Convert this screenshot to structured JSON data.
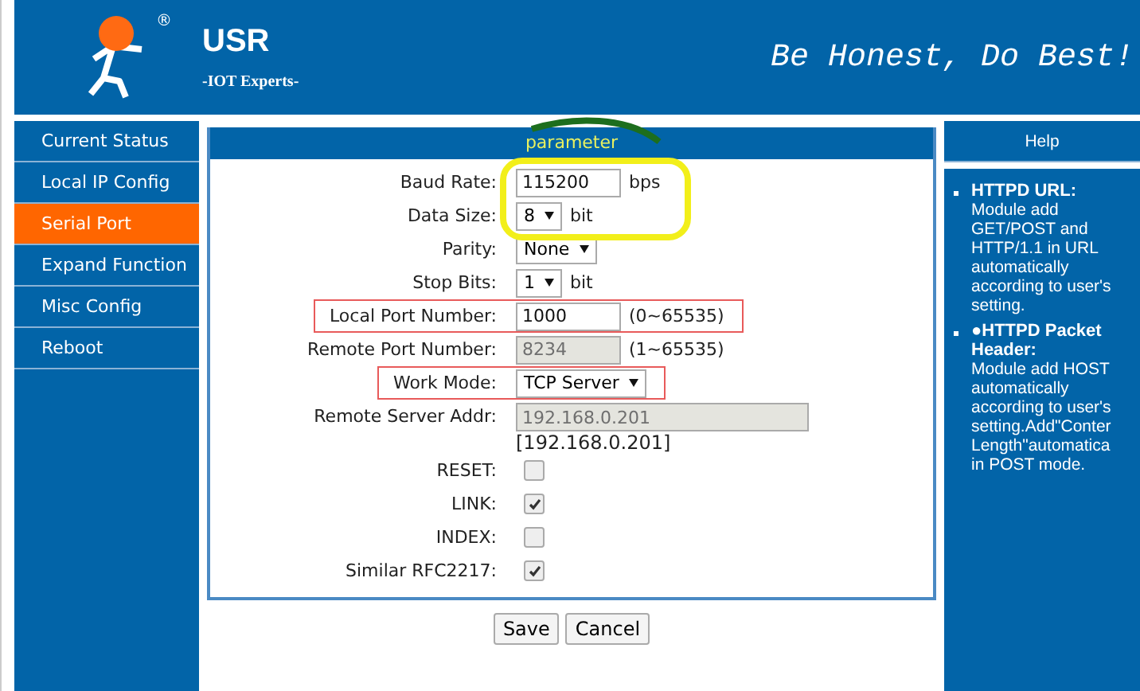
{
  "header": {
    "brand": "USR",
    "tagline": "-IOT Experts-",
    "slogan": "Be Honest, Do Best!",
    "registered": "®"
  },
  "sidebar": {
    "items": [
      {
        "label": "Current Status",
        "selected": false
      },
      {
        "label": "Local IP Config",
        "selected": false
      },
      {
        "label": "Serial Port",
        "selected": true
      },
      {
        "label": "Expand Function",
        "selected": false
      },
      {
        "label": "Misc Config",
        "selected": false
      },
      {
        "label": "Reboot",
        "selected": false
      }
    ]
  },
  "form": {
    "title": "parameter",
    "rows": [
      {
        "kind": "text",
        "label": "Baud Rate:",
        "value": "115200",
        "unit": "bps",
        "disabled": false,
        "highlighted": false
      },
      {
        "kind": "select",
        "label": "Data Size:",
        "value": "8",
        "unit": "bit",
        "highlighted": false
      },
      {
        "kind": "select",
        "label": "Parity:",
        "value": "None",
        "highlighted": false
      },
      {
        "kind": "select",
        "label": "Stop Bits:",
        "value": "1",
        "unit": "bit",
        "highlighted": false
      },
      {
        "kind": "text",
        "label": "Local Port Number:",
        "value": "1000",
        "unit": "(0~65535)",
        "disabled": false,
        "highlighted": true
      },
      {
        "kind": "text",
        "label": "Remote Port Number:",
        "value": "8234",
        "unit": "(1~65535)",
        "disabled": true,
        "highlighted": false
      },
      {
        "kind": "select",
        "label": "Work Mode:",
        "value": "TCP Server",
        "highlighted": true
      },
      {
        "kind": "address",
        "label": "Remote Server Addr:",
        "value": "192.168.0.201",
        "note": "[192.168.0.201]",
        "disabled": true,
        "highlighted": false
      },
      {
        "kind": "checkbox",
        "label": "RESET:",
        "checked": false,
        "highlighted": false
      },
      {
        "kind": "checkbox",
        "label": "LINK:",
        "checked": true,
        "highlighted": false
      },
      {
        "kind": "checkbox",
        "label": "INDEX:",
        "checked": false,
        "highlighted": false
      },
      {
        "kind": "checkbox",
        "label": "Similar RFC2217:",
        "checked": true,
        "highlighted": false
      }
    ],
    "buttons": [
      "Save",
      "Cancel"
    ]
  },
  "help": {
    "title": "Help",
    "items": [
      {
        "title": "HTTPD URL:",
        "lines": [
          "Module add",
          "GET/POST and",
          "HTTP/1.1 in URL",
          "automatically",
          "according to user's",
          "setting."
        ]
      },
      {
        "title": "●HTTPD Packet Header:",
        "lines": [
          "Module add HOST",
          "automatically",
          "according to user's",
          "setting.Add\"Conter",
          "Length\"automatica",
          "in POST mode."
        ]
      }
    ]
  }
}
